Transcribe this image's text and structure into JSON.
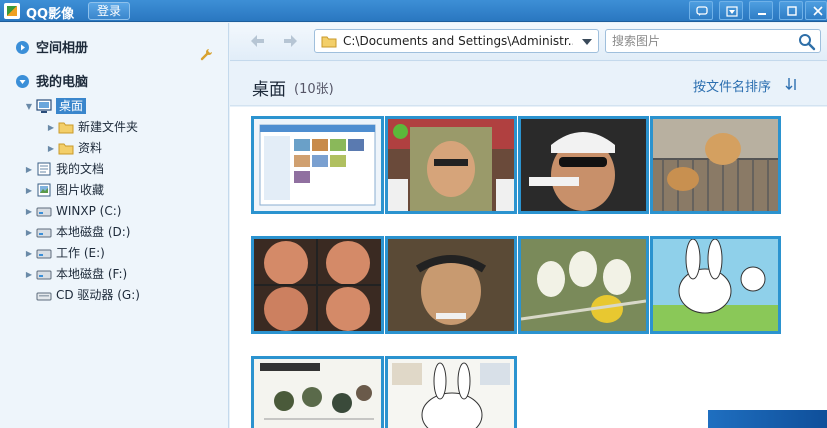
{
  "titlebar": {
    "app_title": "QQ影像",
    "login_label": "登录",
    "buttons": [
      "chat-icon",
      "menu-icon",
      "minimize-icon",
      "maximize-icon",
      "close-icon"
    ]
  },
  "sidebar": {
    "cloud_album_label": "空间相册",
    "my_computer_label": "我的电脑",
    "tree": [
      {
        "label": "桌面",
        "selected": true,
        "icon": "desktop-icon"
      },
      {
        "label": "新建文件夹",
        "icon": "folder-icon"
      },
      {
        "label": "资料",
        "icon": "folder-icon"
      },
      {
        "label": "我的文档",
        "icon": "documents-icon"
      },
      {
        "label": "图片收藏",
        "icon": "pictures-icon"
      },
      {
        "label": "WINXP (C:)",
        "icon": "drive-icon"
      },
      {
        "label": "本地磁盘 (D:)",
        "icon": "drive-icon"
      },
      {
        "label": "工作 (E:)",
        "icon": "drive-icon"
      },
      {
        "label": "本地磁盘 (F:)",
        "icon": "drive-icon"
      },
      {
        "label": "CD 驱动器 (G:)",
        "icon": "cd-drive-icon"
      }
    ]
  },
  "toolbar": {
    "address": "C:\\Documents and Settings\\Administr...",
    "search_placeholder": "搜索图片"
  },
  "content": {
    "folder_title": "桌面",
    "count": "(10张)",
    "sort_label": "按文件名排序"
  },
  "colors": {
    "accent": "#2b93cf",
    "titlebar": "#2a77c0",
    "sidebar_bg": "#eef5fb"
  }
}
